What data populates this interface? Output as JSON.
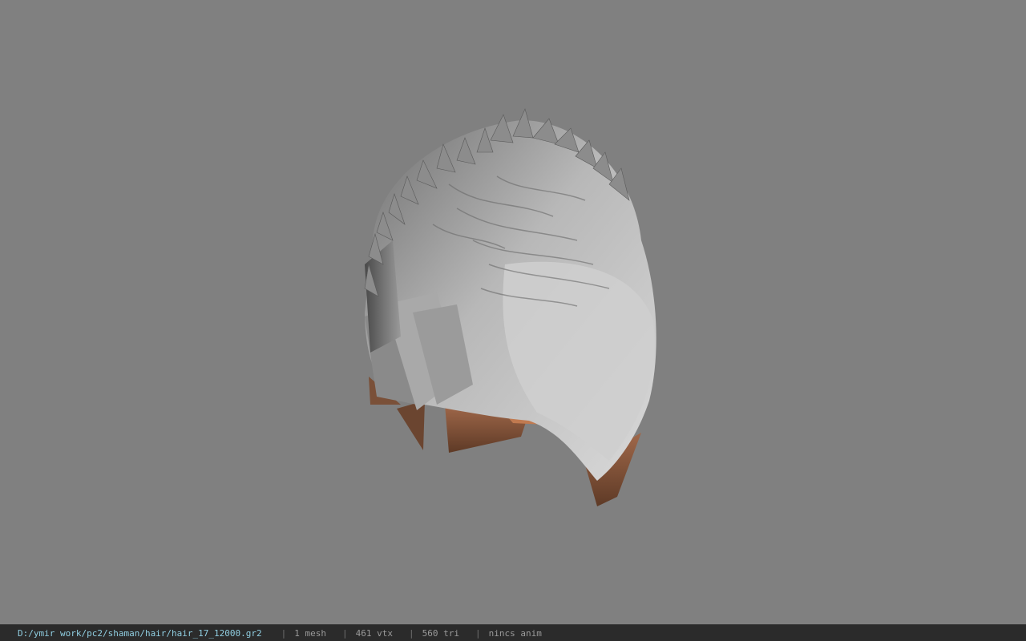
{
  "viewport": {
    "background": "#808080",
    "model_name": "hair mesh"
  },
  "statusbar": {
    "file_path": "D:/ymir work/pc2/shaman/hair/hair_17_12000.gr2",
    "separator": "|",
    "mesh_count": "1 mesh",
    "vertex_count": "461 vtx",
    "triangle_count": "560 tri",
    "anim_status": "nincs anim",
    "path_color": "#8fcde0",
    "text_color": "#9a9a9a"
  }
}
